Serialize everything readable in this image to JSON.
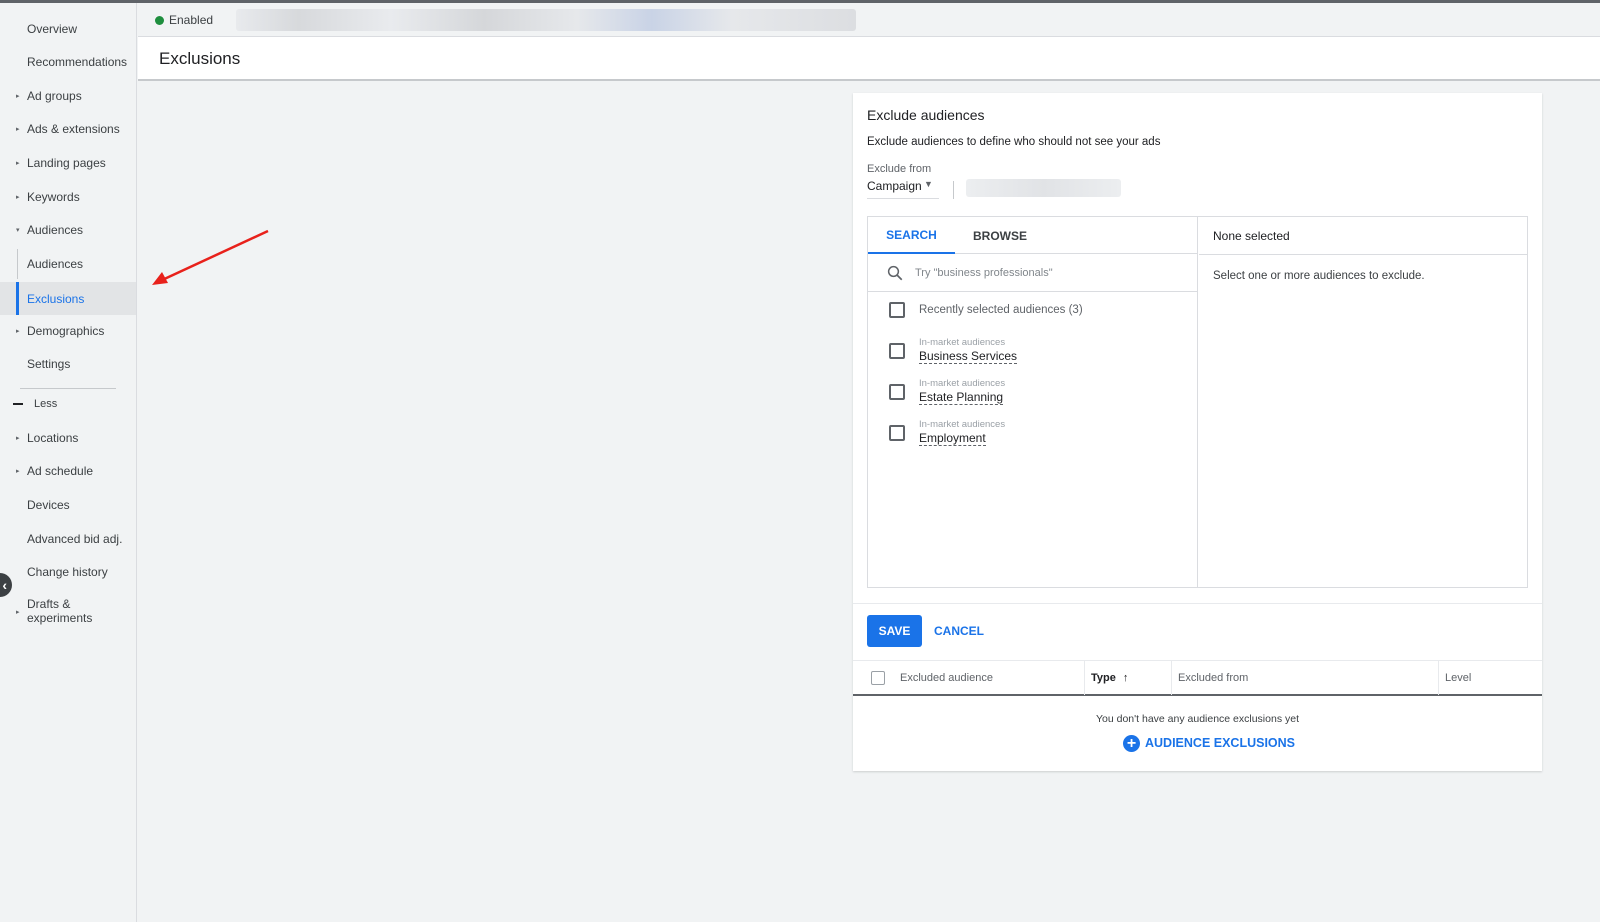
{
  "status": {
    "label": "Enabled",
    "color": "#1e8e3e"
  },
  "page_title": "Exclusions",
  "sidebar": {
    "items": [
      {
        "label": "Overview",
        "caret": ""
      },
      {
        "label": "Recommendations",
        "caret": ""
      },
      {
        "label": "Ad groups",
        "caret": "▸"
      },
      {
        "label": "Ads & extensions",
        "caret": "▸"
      },
      {
        "label": "Landing pages",
        "caret": "▸"
      },
      {
        "label": "Keywords",
        "caret": "▸"
      },
      {
        "label": "Audiences",
        "caret": "▾"
      },
      {
        "label": "Audiences",
        "caret": ""
      },
      {
        "label": "Exclusions",
        "caret": ""
      },
      {
        "label": "Demographics",
        "caret": "▸"
      },
      {
        "label": "Settings",
        "caret": ""
      },
      {
        "label": "Less",
        "caret": ""
      },
      {
        "label": "Locations",
        "caret": "▸"
      },
      {
        "label": "Ad schedule",
        "caret": "▸"
      },
      {
        "label": "Devices",
        "caret": ""
      },
      {
        "label": "Advanced bid adj.",
        "caret": ""
      },
      {
        "label": "Change history",
        "caret": ""
      },
      {
        "label": "Drafts &",
        "label2": "experiments",
        "caret": "▸"
      }
    ],
    "collapse_glyph": "‹"
  },
  "card": {
    "title": "Exclude audiences",
    "description": "Exclude audiences to define who should not see your ads",
    "exclude_from_label": "Exclude from",
    "exclude_from_value": "Campaign",
    "tabs": {
      "search": "SEARCH",
      "browse": "BROWSE"
    },
    "search_placeholder": "Try \"business professionals\"",
    "recent": "Recently selected audiences (3)",
    "audiences": [
      {
        "category": "In-market audiences",
        "name": "Business Services"
      },
      {
        "category": "In-market audiences",
        "name": "Estate Planning"
      },
      {
        "category": "In-market audiences",
        "name": "Employment"
      }
    ],
    "none_selected": "None selected",
    "hint": "Select one or more audiences to exclude.",
    "save_label": "SAVE",
    "cancel_label": "CANCEL",
    "table": {
      "columns": {
        "excluded_audience": "Excluded audience",
        "type": "Type",
        "excluded_from": "Excluded from",
        "level": "Level"
      },
      "sort_glyph": "↑",
      "empty_message": "You don't have any audience exclusions yet",
      "add_label": "AUDIENCE EXCLUSIONS",
      "add_glyph": "+"
    }
  },
  "colors": {
    "accent": "#1a73e8",
    "annotation_arrow": "#e8211b"
  }
}
